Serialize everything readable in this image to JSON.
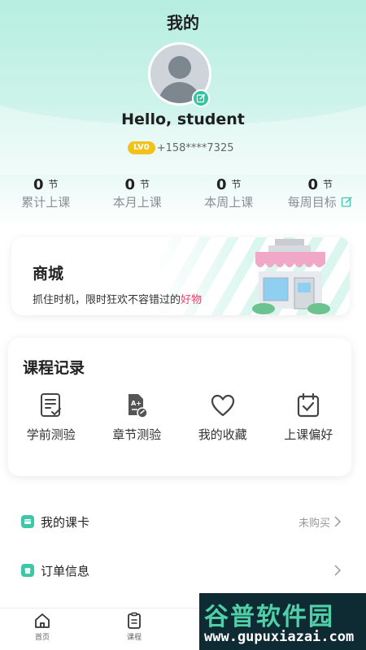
{
  "header": {
    "title": "我的"
  },
  "profile": {
    "name": "Hello, student",
    "level": "LV0",
    "phone": "+158****7325"
  },
  "stats": [
    {
      "value": "0",
      "unit": "节",
      "label": "累计上课"
    },
    {
      "value": "0",
      "unit": "节",
      "label": "本月上课"
    },
    {
      "value": "0",
      "unit": "节",
      "label": "本周上课"
    },
    {
      "value": "0",
      "unit": "节",
      "label": "每周目标"
    }
  ],
  "mall": {
    "title": "商城",
    "subtitle_prefix": "抓住时机，限时狂欢不容错过的",
    "subtitle_highlight": "好物"
  },
  "course_record": {
    "title": "课程记录",
    "items": [
      {
        "label": "学前测验",
        "icon": "document-check-icon"
      },
      {
        "label": "章节测验",
        "icon": "quiz-icon"
      },
      {
        "label": "我的收藏",
        "icon": "heart-icon"
      },
      {
        "label": "上课偏好",
        "icon": "calendar-check-icon"
      }
    ]
  },
  "menu": [
    {
      "label": "我的课卡",
      "value": "未购买",
      "icon": "card-icon"
    },
    {
      "label": "订单信息",
      "value": "",
      "icon": "order-icon"
    }
  ],
  "tabbar": [
    {
      "label": "首页",
      "icon": "home-icon"
    },
    {
      "label": "课程",
      "icon": "clipboard-icon"
    }
  ],
  "watermark": {
    "top": "谷普软件园",
    "bottom": "www.gupuxiazai.com"
  },
  "colors": {
    "accent": "#2ec4a4",
    "highlight": "#e2466b",
    "level_badge": "#f3c21a"
  }
}
